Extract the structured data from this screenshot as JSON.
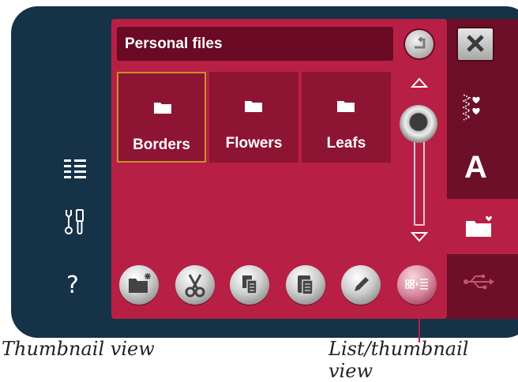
{
  "header": {
    "title": "Personal files"
  },
  "folders": [
    {
      "label": "Borders",
      "selected": true
    },
    {
      "label": "Flowers",
      "selected": false
    },
    {
      "label": "Leafs",
      "selected": false
    }
  ],
  "sidebar": {
    "help_label": "?"
  },
  "tabs": {
    "font_tab_label": "A"
  },
  "icons": {
    "menu": "list-icon",
    "tools": "tools-icon",
    "help": "question-icon",
    "up": "up-folder-icon",
    "close": "close-icon",
    "toolbar": [
      "new-folder-icon",
      "cut-icon",
      "copy-icon",
      "paste-icon",
      "rename-icon",
      "list-thumbnail-icon"
    ]
  },
  "colors": {
    "frame": "#153247",
    "panel": "#b81f45",
    "header": "#6a0a24",
    "folder": "#8e1434",
    "selected_border": "#c6902b"
  },
  "captions": {
    "left": "Thumbnail view",
    "right": "List/thumbnail view"
  }
}
